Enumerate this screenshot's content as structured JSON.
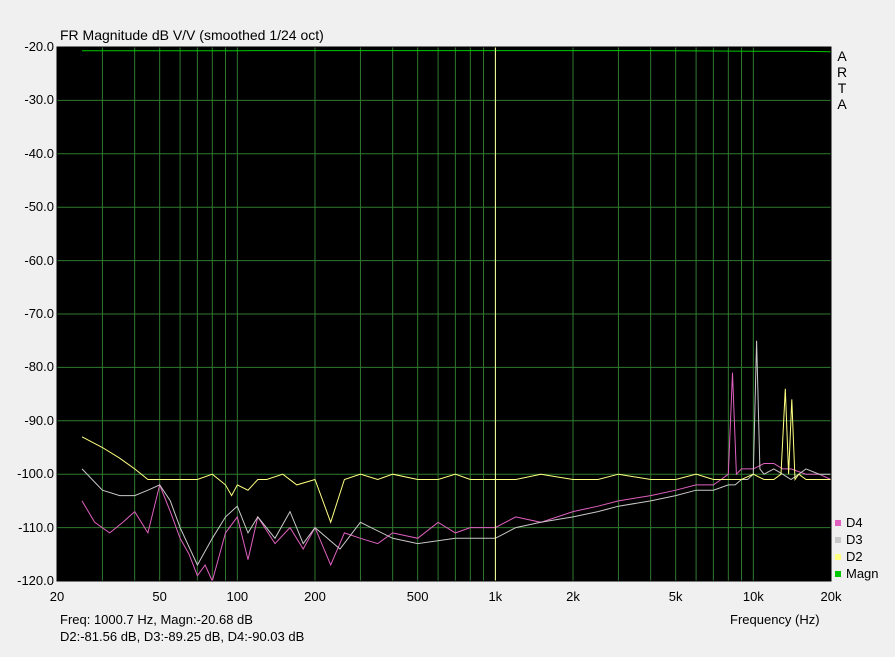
{
  "title": "FR Magnitude dB V/V (smoothed 1/24 oct)",
  "watermark": [
    "A",
    "R",
    "T",
    "A"
  ],
  "readout": {
    "line1": "Freq: 1000.7 Hz, Magn:-20.68 dB",
    "line2": "D2:-81.56 dB, D3:-89.25 dB, D4:-90.03 dB"
  },
  "chart_data": {
    "type": "line",
    "title": "FR Magnitude dB V/V (smoothed 1/24 oct)",
    "xlabel": "Frequency (Hz)",
    "ylabel": "",
    "xscale": "log",
    "xlim": [
      20,
      20000
    ],
    "ylim": [
      -120,
      -20
    ],
    "grid": true,
    "background": "#000000",
    "grid_color": "#2f7a2f",
    "cursor_x": 1000.7,
    "x_tick_labels": [
      "20",
      "50",
      "100",
      "200",
      "500",
      "1k",
      "2k",
      "5k",
      "10k",
      "20k"
    ],
    "x_ticks": [
      20,
      50,
      100,
      200,
      500,
      1000,
      2000,
      5000,
      10000,
      20000
    ],
    "y_tick_labels": [
      "-20.0",
      "-30.0",
      "-40.0",
      "-50.0",
      "-60.0",
      "-70.0",
      "-80.0",
      "-90.0",
      "-100.0",
      "-110.0",
      "-120.0"
    ],
    "y_ticks": [
      -20,
      -30,
      -40,
      -50,
      -60,
      -70,
      -80,
      -90,
      -100,
      -110,
      -120
    ],
    "legend_position": "bottom-right",
    "series": [
      {
        "name": "D4",
        "color": "#e060c0",
        "x": [
          25,
          28,
          32,
          36,
          40,
          45,
          50,
          55,
          60,
          65,
          70,
          75,
          80,
          90,
          100,
          110,
          120,
          140,
          160,
          180,
          200,
          230,
          260,
          300,
          350,
          400,
          500,
          600,
          700,
          800,
          1000,
          1200,
          1500,
          2000,
          2500,
          3000,
          4000,
          5000,
          6000,
          7000,
          7500,
          8000,
          8300,
          8600,
          9000,
          9500,
          10000,
          11000,
          12000,
          13000,
          14000,
          16000,
          18000,
          20000
        ],
        "y": [
          -105,
          -109,
          -111,
          -109,
          -107,
          -111,
          -102,
          -107,
          -112,
          -115,
          -119,
          -117,
          -120,
          -111,
          -108,
          -116,
          -108,
          -113,
          -110,
          -114,
          -110,
          -117,
          -111,
          -112,
          -113,
          -111,
          -112,
          -109,
          -111,
          -110,
          -110,
          -108,
          -109,
          -107,
          -106,
          -105,
          -104,
          -103,
          -102,
          -102,
          -101,
          -100,
          -81,
          -100,
          -99,
          -99,
          -99,
          -98,
          -98,
          -99,
          -99,
          -100,
          -100,
          -101
        ]
      },
      {
        "name": "D3",
        "color": "#c8c8c8",
        "x": [
          25,
          30,
          35,
          40,
          45,
          50,
          55,
          60,
          70,
          80,
          90,
          100,
          110,
          120,
          140,
          160,
          180,
          200,
          250,
          300,
          400,
          500,
          700,
          1000,
          1200,
          1500,
          2000,
          2500,
          3000,
          4000,
          5000,
          6000,
          7000,
          8000,
          8500,
          9000,
          9500,
          10000,
          10300,
          10600,
          11000,
          12000,
          13000,
          14000,
          15000,
          16000,
          18000,
          20000
        ],
        "y": [
          -99,
          -103,
          -104,
          -104,
          -103,
          -102,
          -105,
          -110,
          -117,
          -112,
          -108,
          -106,
          -111,
          -108,
          -112,
          -107,
          -113,
          -110,
          -114,
          -109,
          -112,
          -113,
          -112,
          -112,
          -110,
          -109,
          -108,
          -107,
          -106,
          -105,
          -104,
          -103,
          -103,
          -102,
          -102,
          -101,
          -101,
          -100,
          -75,
          -99,
          -100,
          -99,
          -100,
          -101,
          -100,
          -99,
          -100,
          -100
        ]
      },
      {
        "name": "D2",
        "color": "#ffff80",
        "x": [
          25,
          30,
          35,
          40,
          45,
          50,
          55,
          60,
          70,
          80,
          90,
          95,
          100,
          110,
          120,
          130,
          150,
          170,
          200,
          230,
          260,
          300,
          350,
          400,
          500,
          600,
          700,
          800,
          1000,
          1200,
          1500,
          2000,
          2500,
          3000,
          4000,
          5000,
          6000,
          7000,
          8000,
          9000,
          10000,
          11000,
          12000,
          12800,
          13300,
          13700,
          14100,
          14500,
          15000,
          16000,
          18000,
          20000
        ],
        "y": [
          -93,
          -95,
          -97,
          -99,
          -101,
          -101,
          -101,
          -101,
          -101,
          -100,
          -102,
          -104,
          -102,
          -103,
          -101,
          -101,
          -100,
          -102,
          -101,
          -109,
          -101,
          -100,
          -101,
          -100,
          -101,
          -101,
          -100,
          -101,
          -101,
          -101,
          -100,
          -101,
          -101,
          -100,
          -101,
          -101,
          -100,
          -101,
          -101,
          -101,
          -100,
          -101,
          -101,
          -100,
          -84,
          -100,
          -86,
          -101,
          -100,
          -101,
          -101,
          -101
        ]
      },
      {
        "name": "Magn",
        "color": "#00c800",
        "x": [
          25,
          50,
          100,
          200,
          500,
          1000,
          2000,
          5000,
          10000,
          15000,
          20000
        ],
        "y": [
          -20.7,
          -20.7,
          -20.7,
          -20.68,
          -20.68,
          -20.68,
          -20.68,
          -20.7,
          -20.8,
          -20.8,
          -20.9
        ]
      }
    ]
  }
}
